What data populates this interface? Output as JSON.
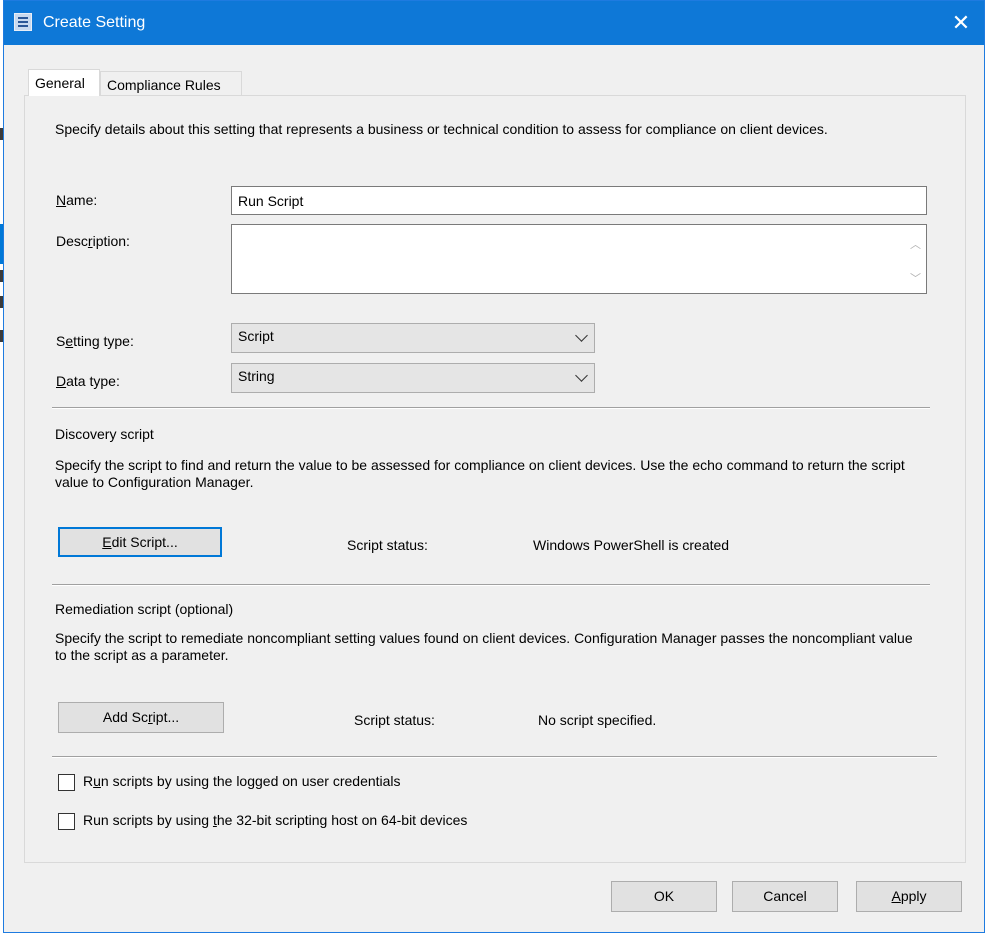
{
  "window": {
    "title": "Create Setting",
    "title_bar_color": "#0e78d7"
  },
  "tabs": [
    {
      "label": "General",
      "active": true
    },
    {
      "label": "Compliance Rules",
      "active": false
    }
  ],
  "general": {
    "intro": "Specify details about this setting that represents a business or technical condition to assess for compliance on client devices.",
    "name_label": "Name:",
    "name_value": "Run Script",
    "description_label": "Description:",
    "description_value": "",
    "setting_type_label": "Setting type:",
    "setting_type_value": "Script",
    "data_type_label": "Data type:",
    "data_type_value": "String",
    "discovery": {
      "heading": "Discovery script",
      "text": "Specify the script to find and return the value to be assessed for compliance on client devices. Use the echo command to return the script value to Configuration Manager.",
      "button": "Edit Script...",
      "status_label": "Script status:",
      "status_value": "Windows PowerShell is created"
    },
    "remediation": {
      "heading": "Remediation script (optional)",
      "text": "Specify the script to remediate noncompliant setting values found on client devices. Configuration Manager passes the noncompliant value to the script as a parameter.",
      "button": "Add Script...",
      "status_label": "Script status:",
      "status_value": "No script specified."
    },
    "options": [
      {
        "label": "Run scripts by using the logged on user credentials",
        "checked": false
      },
      {
        "label": "Run scripts by using the 32-bit scripting host on 64-bit devices",
        "checked": false
      }
    ]
  },
  "footer": {
    "ok": "OK",
    "cancel": "Cancel",
    "apply": "Apply"
  },
  "icons": [
    "app-icon",
    "close-icon",
    "scroll-up-icon",
    "scroll-down-icon",
    "chevron-down-icon"
  ]
}
